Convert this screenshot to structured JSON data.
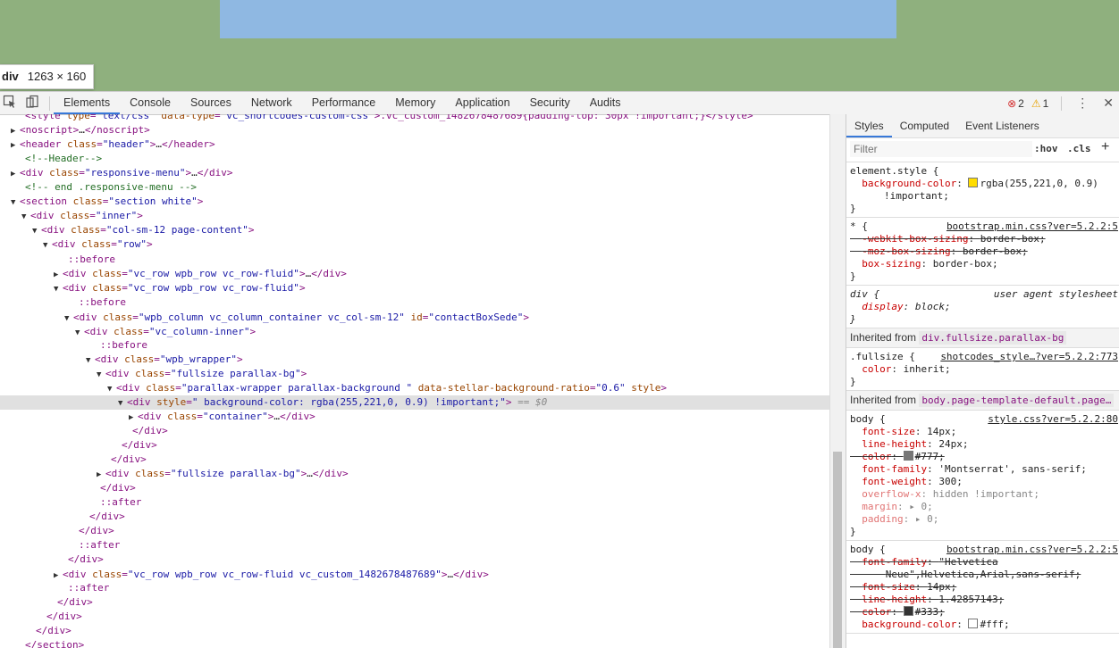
{
  "tooltip": {
    "tag": "div",
    "size": "1263 × 160"
  },
  "toolbar": {
    "tabs": [
      "Elements",
      "Console",
      "Sources",
      "Network",
      "Performance",
      "Memory",
      "Application",
      "Security",
      "Audits"
    ],
    "active_tab": "Elements",
    "errors": "2",
    "warnings": "1"
  },
  "elements": {
    "lines": [
      {
        "t": "<style type=\"text/css\" data-type=\"vc_shortcodes-custom-css\">.vc_custom_1482678487689{padding-top: 30px !important;}</style>"
      },
      {
        "t": "<noscript>…</noscript>"
      },
      {
        "t": "<header class=\"header\">…</header>"
      },
      {
        "t": "<!--Header-->"
      },
      {
        "t": "<div class=\"responsive-menu\">…</div>"
      },
      {
        "t": "<!-- end .responsive-menu -->"
      },
      {
        "t": "<section class=\"section white\">"
      },
      {
        "t": "<div class=\"inner\">"
      },
      {
        "t": "<div class=\"col-sm-12 page-content\">"
      },
      {
        "t": "<div class=\"row\">"
      },
      {
        "t": "::before"
      },
      {
        "t": "<div class=\"vc_row wpb_row vc_row-fluid\">…</div>"
      },
      {
        "t": "<div class=\"vc_row wpb_row vc_row-fluid\">"
      },
      {
        "t": "::before"
      },
      {
        "t": "<div class=\"wpb_column vc_column_container vc_col-sm-12\" id=\"contactBoxSede\">"
      },
      {
        "t": "<div class=\"vc_column-inner\">"
      },
      {
        "t": "::before"
      },
      {
        "t": "<div class=\"wpb_wrapper\">"
      },
      {
        "t": "<div class=\"fullsize parallax-bg\">"
      },
      {
        "t": "<div class=\"parallax-wrapper parallax-background \" data-stellar-background-ratio=\"0.6\" style>"
      },
      {
        "t": "<div style=\" background-color: rgba(255,221,0, 0.9) !important;\">"
      },
      {
        "t": "<div class=\"container\">…</div>"
      },
      {
        "t": "</div>"
      },
      {
        "t": "</div>"
      },
      {
        "t": "</div>"
      },
      {
        "t": "<div class=\"fullsize parallax-bg\">…</div>"
      },
      {
        "t": "</div>"
      },
      {
        "t": "::after"
      },
      {
        "t": "</div>"
      },
      {
        "t": "</div>"
      },
      {
        "t": "::after"
      },
      {
        "t": "</div>"
      },
      {
        "t": "<div class=\"vc_row wpb_row vc_row-fluid vc_custom_1482678487689\">…</div>"
      },
      {
        "t": "::after"
      },
      {
        "t": "</div>"
      },
      {
        "t": "</div>"
      },
      {
        "t": "</div>"
      },
      {
        "t": "</section>"
      }
    ],
    "selected_suffix": "== $0"
  },
  "styles": {
    "tabs": [
      "Styles",
      "Computed",
      "Event Listeners"
    ],
    "filter_placeholder": "Filter",
    "hov": ":hov",
    "cls": ".cls",
    "plus": "+",
    "element_style": {
      "selector": "element.style {",
      "prop": "background-color",
      "value": "rgba(255,221,0, 0.9)",
      "important": "!important;",
      "swatch": "#ffdd00"
    },
    "universal": {
      "selector": "* {",
      "source": "bootstrap.min.css?ver=5.2.2:5",
      "decls": [
        {
          "p": "-webkit-box-sizing",
          "v": "border-box;"
        },
        {
          "p": "-moz-box-sizing",
          "v": "border-box;"
        },
        {
          "p": "box-sizing",
          "v": "border-box;"
        }
      ]
    },
    "div_ua": {
      "selector": "div {",
      "source": "user agent stylesheet",
      "p": "display",
      "v": "block;"
    },
    "inherited1": {
      "label": "Inherited from",
      "node": "div.fullsize.parallax-bg"
    },
    "fullsize": {
      "selector": ".fullsize {",
      "source": "shotcodes_style…?ver=5.2.2:773",
      "p": "color",
      "v": "inherit;"
    },
    "inherited2": {
      "label": "Inherited from",
      "node": "body.page-template-default.page…"
    },
    "body1": {
      "selector": "body {",
      "source": "style.css?ver=5.2.2:80",
      "decls": [
        {
          "p": "font-size",
          "v": "14px;"
        },
        {
          "p": "line-height",
          "v": "24px;"
        },
        {
          "p": "color",
          "v": "#777;"
        },
        {
          "p": "font-family",
          "v": "'Montserrat', sans-serif;"
        },
        {
          "p": "font-weight",
          "v": "300;"
        },
        {
          "p": "overflow-x",
          "v": "hidden !important;"
        },
        {
          "p": "margin",
          "v": "▸ 0;"
        },
        {
          "p": "padding",
          "v": "▸ 0;"
        }
      ]
    },
    "body2": {
      "selector": "body {",
      "source": "bootstrap.min.css?ver=5.2.2:5",
      "decls": [
        {
          "p": "font-family",
          "v": "\"Helvetica"
        },
        {
          "p": "",
          "v": "Neue\",Helvetica,Arial,sans-serif;"
        },
        {
          "p": "font-size",
          "v": "14px;"
        },
        {
          "p": "line-height",
          "v": "1.42857143;"
        },
        {
          "p": "color",
          "v": "#333;"
        },
        {
          "p": "background-color",
          "v": "#fff;"
        }
      ]
    },
    "close": "}"
  }
}
